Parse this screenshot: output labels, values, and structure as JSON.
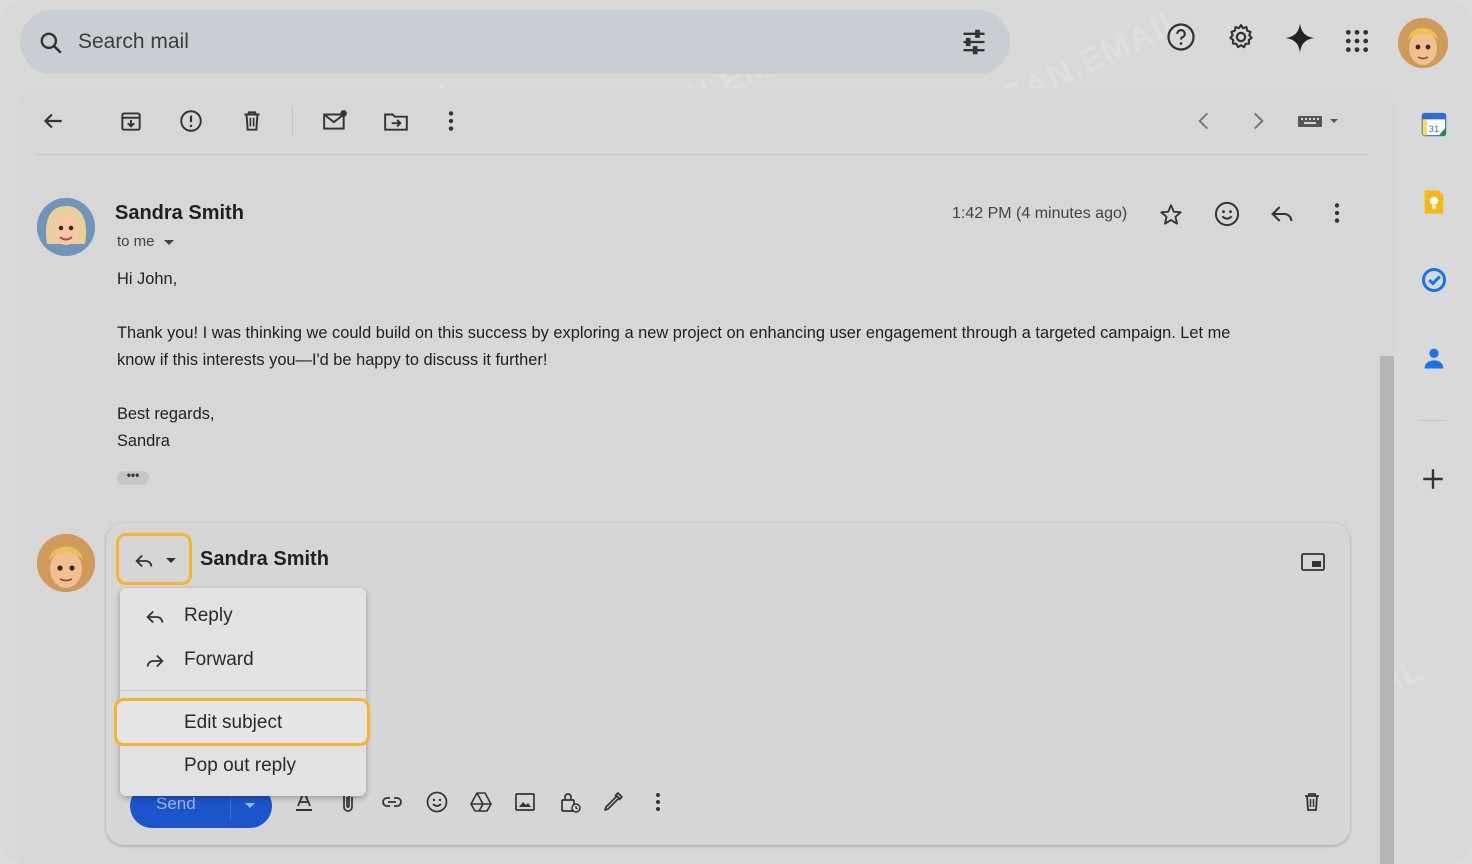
{
  "search": {
    "placeholder": "Search mail"
  },
  "header_icons": [
    "search-icon",
    "tune-icon",
    "help-icon",
    "gear-icon",
    "sparkle-icon",
    "apps-grid-icon",
    "avatar"
  ],
  "toolbar": {
    "icons": [
      "back-arrow-icon",
      "archive-icon",
      "report-spam-icon",
      "delete-icon",
      "mark-unread-icon",
      "move-to-icon",
      "more-vert-icon",
      "prev-icon",
      "next-icon",
      "keyboard-icon"
    ]
  },
  "message": {
    "sender": "Sandra Smith",
    "to": "to me",
    "time": "1:42 PM (4 minutes ago)",
    "greeting": "Hi John,",
    "body_line1": "Thank you! I was thinking we could build on this success by exploring a new project on enhancing user engagement through a targeted campaign. Let me",
    "body_line2": "know if this interests you—I'd be happy to discuss it further!",
    "closing": "Best regards,",
    "signature": "Sandra",
    "dots": "•••"
  },
  "reply": {
    "recipient": "Sandra Smith",
    "send_label": "Send",
    "menu": {
      "reply": "Reply",
      "forward": "Forward",
      "edit_subject": "Edit subject",
      "pop_out": "Pop out reply"
    }
  },
  "rail": {
    "calendar_day": "31"
  },
  "watermark": "CLEAN.EMAIL",
  "colors": {
    "highlight": "#f5b52c",
    "send": "#1b55c9"
  }
}
